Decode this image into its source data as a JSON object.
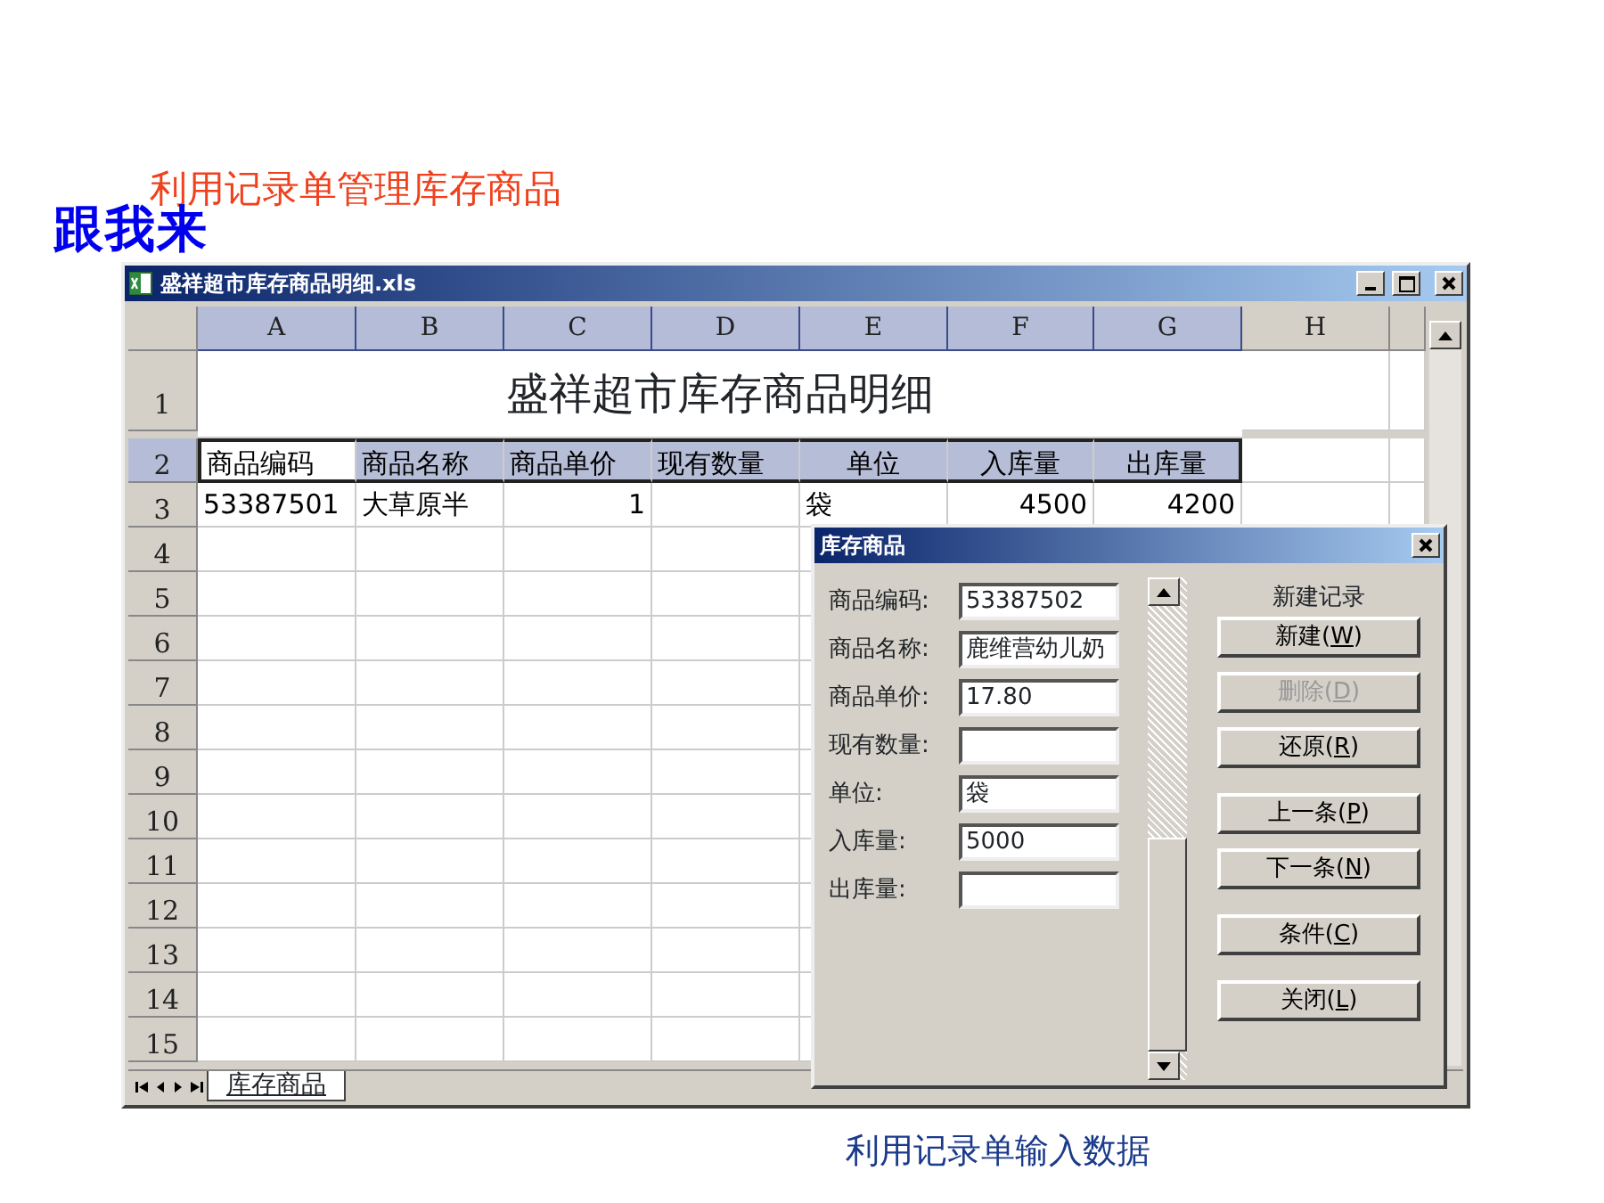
{
  "slide": {
    "heading": "利用记录单管理库存商品",
    "badge": "跟我来",
    "caption": "利用记录单输入数据"
  },
  "window": {
    "title": "盛祥超市库存商品明细.xls"
  },
  "sheet": {
    "columns": [
      {
        "label": "A",
        "selected": true
      },
      {
        "label": "B",
        "selected": true
      },
      {
        "label": "C",
        "selected": true
      },
      {
        "label": "D",
        "selected": true
      },
      {
        "label": "E",
        "selected": true
      },
      {
        "label": "F",
        "selected": true
      },
      {
        "label": "G",
        "selected": true
      },
      {
        "label": "H",
        "selected": false
      }
    ],
    "rows": [
      {
        "number": "1",
        "selected": false,
        "title": "盛祥超市库存商品明细"
      },
      {
        "number": "2",
        "selected": true,
        "cells": [
          {
            "text": "商品编码",
            "kind": "text",
            "active": true
          },
          {
            "text": "商品名称",
            "kind": "text",
            "active": false
          },
          {
            "text": "商品单价",
            "kind": "text",
            "active": false
          },
          {
            "text": "现有数量",
            "kind": "text",
            "active": false
          },
          {
            "text": "单位",
            "kind": "center",
            "active": false
          },
          {
            "text": "入库量",
            "kind": "center",
            "active": false
          },
          {
            "text": "出库量",
            "kind": "center",
            "active": false
          }
        ]
      },
      {
        "number": "3",
        "selected": false,
        "cells": [
          {
            "text": "53387501",
            "kind": "text"
          },
          {
            "text": "大草原半",
            "kind": "text"
          },
          {
            "text": "1",
            "kind": "number"
          },
          {
            "kind": "text"
          },
          {
            "text": "袋",
            "kind": "text"
          },
          {
            "text": "4500",
            "kind": "number"
          },
          {
            "text": "4200",
            "kind": "number"
          }
        ]
      },
      {
        "number": "4",
        "selected": false
      },
      {
        "number": "5",
        "selected": false
      },
      {
        "number": "6",
        "selected": false
      },
      {
        "number": "7",
        "selected": false
      },
      {
        "number": "8",
        "selected": false
      },
      {
        "number": "9",
        "selected": false
      },
      {
        "number": "10",
        "selected": false
      },
      {
        "number": "11",
        "selected": false
      },
      {
        "number": "12",
        "selected": false
      },
      {
        "number": "13",
        "selected": false
      },
      {
        "number": "14",
        "selected": false
      },
      {
        "number": "15",
        "selected": false
      }
    ],
    "tabs": [
      {
        "label": "库存商品",
        "selected": true
      }
    ]
  },
  "dialog": {
    "title": "库存商品",
    "fields": [
      {
        "label": "商品编码:",
        "value": "53387502"
      },
      {
        "label": "商品名称:",
        "value": "鹿维营幼儿奶"
      },
      {
        "label": "商品单价:",
        "value": "17.80"
      },
      {
        "label": "现有数量:"
      },
      {
        "label": "单位:",
        "value": "袋"
      },
      {
        "label": "入库量:",
        "value": "5000"
      },
      {
        "label": "出库量:"
      }
    ],
    "record_status": "新建记录",
    "button_groups": [
      [
        {
          "label": "新建(",
          "key": "W",
          "end": ")",
          "disabled": false
        },
        {
          "label": "删除(",
          "key": "D",
          "end": ")",
          "disabled": true
        },
        {
          "label": "还原(",
          "key": "R",
          "end": ")",
          "disabled": false
        }
      ],
      [
        {
          "label": "上一条(",
          "key": "P",
          "end": ")",
          "disabled": false
        },
        {
          "label": "下一条(",
          "key": "N",
          "end": ")",
          "disabled": false
        }
      ],
      [
        {
          "label": "条件(",
          "key": "C",
          "end": ")",
          "disabled": false
        }
      ],
      [
        {
          "label": "关闭(",
          "key": "L",
          "end": ")",
          "disabled": false
        }
      ]
    ]
  }
}
